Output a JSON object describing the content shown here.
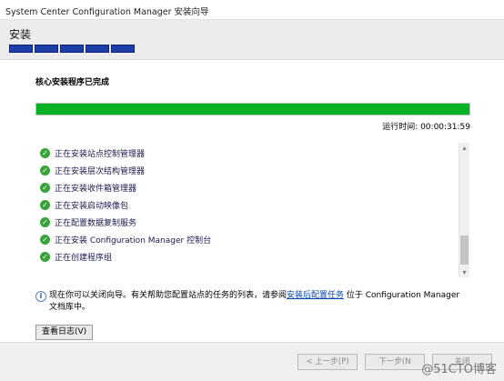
{
  "window": {
    "title": "System Center Configuration Manager 安装向导"
  },
  "header": {
    "heading": "安装",
    "step_count": 5
  },
  "status": {
    "label": "核心安装程序已完成",
    "progress": 1.0,
    "elapsed": "运行时间: 00:00:31:59"
  },
  "steps": [
    {
      "label": "正在安装站点控制管理器",
      "state": "done"
    },
    {
      "label": "正在安装层次结构管理器",
      "state": "done"
    },
    {
      "label": "正在安装收件箱管理器",
      "state": "done"
    },
    {
      "label": "正在安装启动映像包",
      "state": "done"
    },
    {
      "label": "正在配置数据复制服务",
      "state": "done"
    },
    {
      "label": "正在安装 Configuration Manager 控制台",
      "state": "done"
    },
    {
      "label": "正在创建程序组",
      "state": "done"
    }
  ],
  "info": {
    "prefix": "现在你可以关闭向导。有关帮助您配置站点的任务的列表，请参阅",
    "link": "安装后配置任务",
    "suffix": " 位于 Configuration Manager 文档库中。"
  },
  "buttons": {
    "view_log": "查看日志(V)",
    "back": "< 上一步(P)",
    "next": "下一步(N",
    "close": "关闭"
  },
  "watermark": "@51CTO博客",
  "colors": {
    "progress": "#06b025",
    "step_bar": "#1f3fa8",
    "check": "#3aa23a"
  }
}
